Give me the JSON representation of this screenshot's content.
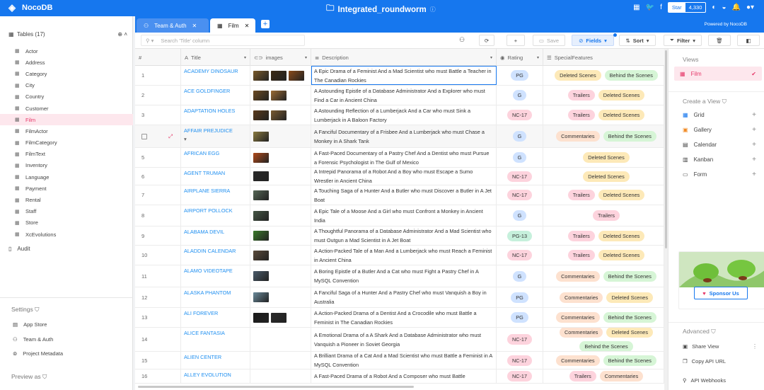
{
  "app": {
    "name": "NocoDB",
    "project": "Integrated_roundworm",
    "star_label": "Star",
    "star_count": "4,330",
    "powered": "Powered by NocoDB"
  },
  "sidebar": {
    "tables_header": "Tables (17)",
    "tables": [
      "Actor",
      "Address",
      "Category",
      "City",
      "Country",
      "Customer",
      "Film",
      "FilmActor",
      "FilmCategory",
      "FilmText",
      "Inventory",
      "Language",
      "Payment",
      "Rental",
      "Staff",
      "Store",
      "XcEvolutions"
    ],
    "active": "Film",
    "audit": "Audit",
    "settings_title": "Settings",
    "settings_items": [
      "App Store",
      "Team & Auth",
      "Project Metadata"
    ],
    "preview": "Preview as"
  },
  "tabs": [
    {
      "label": "Team & Auth"
    },
    {
      "label": "Film"
    }
  ],
  "toolbar": {
    "search_placeholder": "Search 'Title' column",
    "save": "Save",
    "fields": "Fields",
    "sort": "Sort",
    "filter": "Filter"
  },
  "columns": [
    "#",
    "Title",
    "images",
    "Description",
    "Rating",
    "SpecialFeatures"
  ],
  "rows": [
    {
      "n": "1",
      "title": "ACADEMY DINOSAUR",
      "imgs": 3,
      "desc": "A Epic Drama of a Feminist And a Mad Scientist who must Battle a Teacher in The Canadian Rockies",
      "rating": "PG",
      "spec": [
        "Deleted Scenes",
        "Behind the Scenes"
      ]
    },
    {
      "n": "2",
      "title": "ACE GOLDFINGER",
      "imgs": 2,
      "desc": "A Astounding Epistle of a Database Administrator And a Explorer who must Find a Car in Ancient China",
      "rating": "G",
      "spec": [
        "Trailers",
        "Deleted Scenes"
      ]
    },
    {
      "n": "3",
      "title": "ADAPTATION HOLES",
      "imgs": 2,
      "desc": "A Astounding Reflection of a Lumberjack And a Car who must Sink a Lumberjack in A Baloon Factory",
      "rating": "NC-17",
      "spec": [
        "Trailers",
        "Deleted Scenes"
      ]
    },
    {
      "n": "",
      "title": "AFFAIR PREJUDICE",
      "imgs": 1,
      "desc": "A Fanciful Documentary of a Frisbee And a Lumberjack who must Chase a Monkey in A Shark Tank",
      "rating": "G",
      "spec": [
        "Commentaries",
        "Behind the Scenes"
      ]
    },
    {
      "n": "5",
      "title": "AFRICAN EGG",
      "imgs": 1,
      "desc": "A Fast-Paced Documentary of a Pastry Chef And a Dentist who must Pursue a Forensic Psychologist in The Gulf of Mexico",
      "rating": "G",
      "spec": [
        "Deleted Scenes"
      ]
    },
    {
      "n": "6",
      "title": "AGENT TRUMAN",
      "imgs": 1,
      "desc": "A Intrepid Panorama of a Robot And a Boy who must Escape a Sumo Wrestler in Ancient China",
      "rating": "NC-17",
      "spec": [
        "Deleted Scenes"
      ]
    },
    {
      "n": "7",
      "title": "AIRPLANE SIERRA",
      "imgs": 1,
      "desc": "A Touching Saga of a Hunter And a Butler who must Discover a Butler in A Jet Boat",
      "rating": "NC-17",
      "spec": [
        "Trailers",
        "Deleted Scenes"
      ]
    },
    {
      "n": "8",
      "title": "AIRPORT POLLOCK",
      "imgs": 1,
      "desc": "A Epic Tale of a Moose And a Girl who must Confront a Monkey in Ancient India",
      "rating": "G",
      "spec": [
        "Trailers"
      ]
    },
    {
      "n": "9",
      "title": "ALABAMA DEVIL",
      "imgs": 1,
      "desc": "A Thoughtful Panorama of a Database Administrator And a Mad Scientist who must Outgun a Mad Scientist in A Jet Boat",
      "rating": "PG-13",
      "spec": [
        "Trailers",
        "Deleted Scenes"
      ]
    },
    {
      "n": "10",
      "title": "ALADDIN CALENDAR",
      "imgs": 1,
      "desc": "A Action-Packed Tale of a Man And a Lumberjack who must Reach a Feminist in Ancient China",
      "rating": "NC-17",
      "spec": [
        "Trailers",
        "Deleted Scenes"
      ]
    },
    {
      "n": "11",
      "title": "ALAMO VIDEOTAPE",
      "imgs": 1,
      "desc": "A Boring Epistle of a Butler And a Cat who must Fight a Pastry Chef in A MySQL Convention",
      "rating": "G",
      "spec": [
        "Commentaries",
        "Behind the Scenes"
      ]
    },
    {
      "n": "12",
      "title": "ALASKA PHANTOM",
      "imgs": 1,
      "desc": "A Fanciful Saga of a Hunter And a Pastry Chef who must Vanquish a Boy in Australia",
      "rating": "PG",
      "spec": [
        "Commentaries",
        "Deleted Scenes"
      ]
    },
    {
      "n": "13",
      "title": "ALI FOREVER",
      "imgs": 2,
      "desc": "A Action-Packed Drama of a Dentist And a Crocodile who must Battle a Feminist in The Canadian Rockies",
      "rating": "PG",
      "spec": [
        "Commentaries",
        "Behind the Scenes"
      ]
    },
    {
      "n": "14",
      "title": "ALICE FANTASIA",
      "imgs": 0,
      "desc": "A Emotional Drama of a A Shark And a Database Administrator who must Vanquish a Pioneer in Soviet Georgia",
      "rating": "NC-17",
      "spec": [
        "Commentaries",
        "Deleted Scenes",
        "Behind the Scenes"
      ]
    },
    {
      "n": "15",
      "title": "ALIEN CENTER",
      "imgs": 0,
      "desc": "A Brilliant Drama of a Cat And a Mad Scientist who must Battle a Feminist in A MySQL Convention",
      "rating": "NC-17",
      "spec": [
        "Commentaries",
        "Behind the Scenes"
      ]
    },
    {
      "n": "16",
      "title": "ALLEY EVOLUTION",
      "imgs": 0,
      "desc": "A Fast-Paced Drama of a Robot And a Composer who must Battle",
      "rating": "NC-17",
      "spec": [
        "Trailers",
        "Commentaries"
      ]
    }
  ],
  "right_panel": {
    "views_title": "Views",
    "view_active": "Film",
    "create_title": "Create a View",
    "create_items": [
      "Grid",
      "Gallery",
      "Calendar",
      "Kanban",
      "Form"
    ],
    "sponsor": "Sponsor Us",
    "advanced_title": "Advanced",
    "advanced_items": [
      "Share View",
      "Copy API URL",
      "API Webhooks"
    ]
  },
  "colors": {
    "primary": "#1677ee",
    "active_pink": "#e6396a"
  }
}
